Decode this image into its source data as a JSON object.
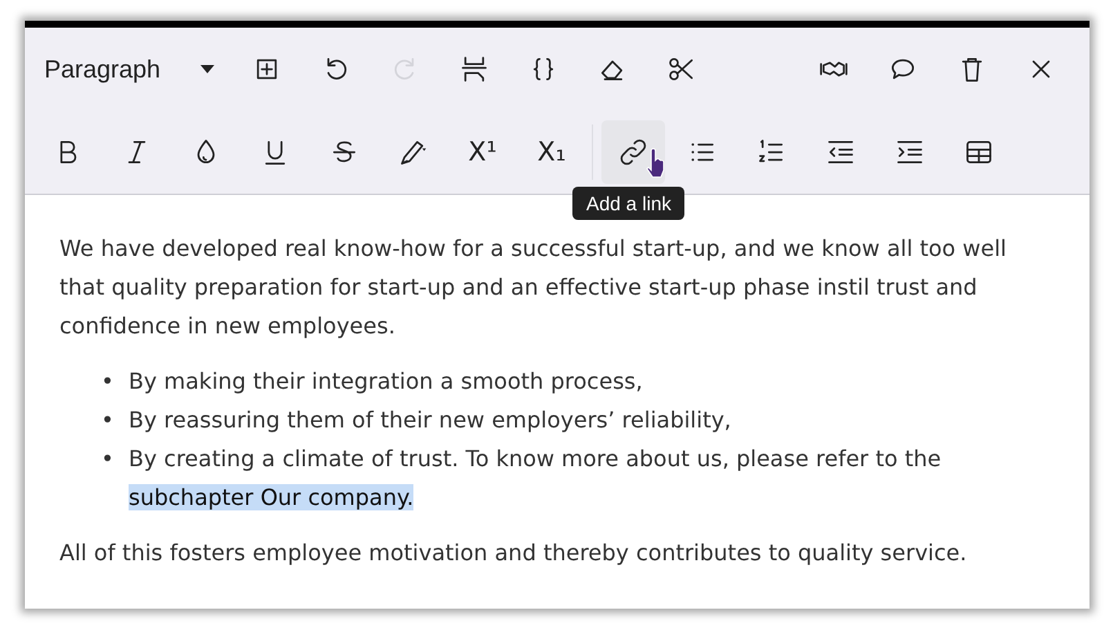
{
  "toolbar_row_1": [
    {
      "kind": "dropdown",
      "label": "Paragraph"
    },
    {
      "kind": "icon",
      "disabled": false
    },
    {
      "kind": "icon",
      "disabled": false
    },
    {
      "kind": "icon",
      "disabled": true
    },
    {
      "kind": "icon",
      "disabled": false
    },
    {
      "kind": "icon",
      "disabled": false
    },
    {
      "kind": "icon",
      "disabled": false
    },
    {
      "kind": "icon",
      "disabled": false
    },
    {
      "kind": "spacer"
    },
    {
      "kind": "icon",
      "disabled": false
    },
    {
      "kind": "icon",
      "disabled": false
    },
    {
      "kind": "icon",
      "disabled": false
    },
    {
      "kind": "icon",
      "disabled": false
    }
  ],
  "toolbar_row_2": [
    {
      "kind": "icon",
      "hovered": false
    },
    {
      "kind": "icon",
      "hovered": false
    },
    {
      "kind": "icon",
      "hovered": false
    },
    {
      "kind": "icon",
      "hovered": false
    },
    {
      "kind": "icon",
      "hovered": false
    },
    {
      "kind": "icon",
      "hovered": false
    },
    {
      "kind": "glyph",
      "glyph": "X¹",
      "hovered": false
    },
    {
      "kind": "glyph",
      "glyph": "X₁",
      "hovered": false
    },
    {
      "kind": "separator"
    },
    {
      "kind": "icon",
      "hovered": true,
      "tooltip": "Add a link"
    },
    {
      "kind": "icon",
      "hovered": false
    },
    {
      "kind": "icon",
      "hovered": false
    },
    {
      "kind": "icon",
      "hovered": false
    },
    {
      "kind": "icon",
      "hovered": false
    },
    {
      "kind": "icon",
      "hovered": false
    }
  ],
  "content": [
    {
      "kind": "paragraph",
      "text": "We have developed real know-how for a successful start-up, and we know all too well that quality preparation for start-up and an effective start-up phase instil trust and confidence in new employees."
    },
    {
      "kind": "list",
      "items": [
        {
          "marker": "•",
          "parts": [
            {
              "text": "By making their integration a smooth process,",
              "selected": false
            }
          ]
        },
        {
          "marker": "•",
          "parts": [
            {
              "text": "By reassuring them of their new employers’ reliability,",
              "selected": false
            }
          ]
        },
        {
          "marker": "•",
          "parts": [
            {
              "text": "By creating a climate of trust. To know more about us, please refer to the ",
              "selected": false
            },
            {
              "text": "subchapter Our company.",
              "selected": true
            }
          ]
        }
      ]
    },
    {
      "kind": "paragraph",
      "text": "All of this fosters employee motivation and thereby contributes to quality service."
    }
  ]
}
